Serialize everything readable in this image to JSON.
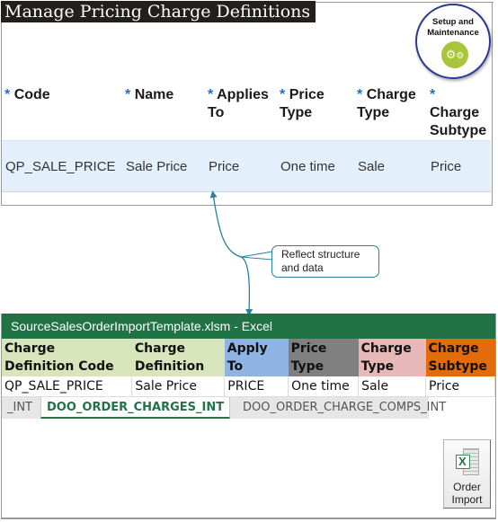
{
  "oracle_page": {
    "title": "Manage Pricing Charge Definitions",
    "setup_badge": {
      "label_line1": "Setup and",
      "label_line2": "Maintenance",
      "icon": "gears-icon",
      "accent_color": "#a9c53b",
      "ring_color": "#2b3a8c"
    },
    "required_marker": "*",
    "columns": [
      {
        "line1": "Code",
        "line2": ""
      },
      {
        "line1": "Name",
        "line2": ""
      },
      {
        "line1": "Applies",
        "line2": "To"
      },
      {
        "line1": "Price",
        "line2": "Type"
      },
      {
        "line1": "Charge",
        "line2": "Type"
      },
      {
        "line1": "Charge",
        "line2": "Subtype"
      }
    ],
    "row": [
      "QP_SALE_PRICE",
      "Sale Price",
      "Price",
      "One time",
      "Sale",
      "Price"
    ]
  },
  "callout": {
    "line1": "Reflect structure",
    "line2": "and data",
    "color": "#2a8198"
  },
  "excel": {
    "title": "SourceSalesOrderImportTemplate.xlsm - Excel",
    "title_color": "#217346",
    "columns": [
      {
        "line1": "Charge",
        "line2": "Definition Code",
        "bg": "#d8e4bc"
      },
      {
        "line1": "Charge",
        "line2": "Definition",
        "bg": "#d8e4bc"
      },
      {
        "line1": "Apply",
        "line2": "To",
        "bg": "#8db4e2"
      },
      {
        "line1": "Price",
        "line2": "Type",
        "bg": "#808080"
      },
      {
        "line1": "Charge",
        "line2": "Type",
        "bg": "#e6b8b7"
      },
      {
        "line1": "Charge",
        "line2": "Subtype",
        "bg": "#e26b0a"
      }
    ],
    "row": [
      "QP_SALE_PRICE",
      "Sale Price",
      "PRICE",
      "One time",
      "Sale",
      "Price"
    ],
    "sheet_tabs": [
      {
        "label": "_INT",
        "active": false
      },
      {
        "label": "DOO_ORDER_CHARGES_INT",
        "active": true
      },
      {
        "label": "DOO_ORDER_CHARGE_COMPS_INT",
        "active": false
      }
    ],
    "order_import_button": {
      "line1": "Order",
      "line2": "Import",
      "icon": "excel-icon"
    }
  }
}
